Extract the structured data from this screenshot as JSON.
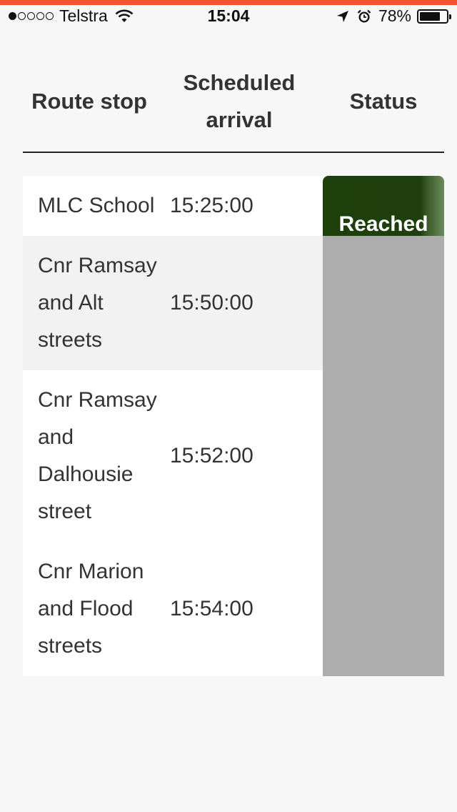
{
  "status_bar": {
    "signal_filled": 1,
    "signal_total": 5,
    "carrier": "Telstra",
    "wifi_icon": "wifi-icon",
    "time": "15:04",
    "location_icon": "location-arrow-icon",
    "alarm_icon": "alarm-clock-icon",
    "battery_percent": "78%",
    "battery_level": 0.78
  },
  "colors": {
    "accent": "#f0542f",
    "reached": "#1d3f0c",
    "status_pending": "#adadad"
  },
  "table": {
    "headers": {
      "route_stop": "Route stop",
      "scheduled_arrival": "Scheduled arrival",
      "status": "Status"
    },
    "rows": [
      {
        "stop": "MLC School",
        "arrival": "15:25:00",
        "status": "Reached"
      },
      {
        "stop": "Cnr Ramsay and Alt streets",
        "arrival": "15:50:00",
        "status": ""
      },
      {
        "stop": "Cnr Ramsay and Dalhousie street",
        "arrival": "15:52:00",
        "status": ""
      },
      {
        "stop": "Cnr Marion and Flood streets",
        "arrival": "15:54:00",
        "status": ""
      }
    ]
  }
}
